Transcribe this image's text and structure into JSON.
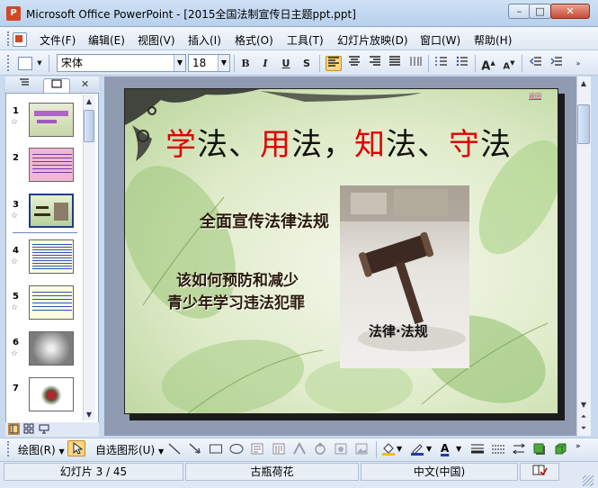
{
  "window": {
    "title": "Microsoft Office PowerPoint - [2015全国法制宣传日主题ppt.ppt]",
    "minimize": "–",
    "maximize": "□",
    "close": "✕"
  },
  "menu": [
    "文件(F)",
    "编辑(E)",
    "视图(V)",
    "插入(I)",
    "格式(O)",
    "工具(T)",
    "幻灯片放映(D)",
    "窗口(W)",
    "帮助(H)"
  ],
  "toolbar": {
    "font_name": "宋体",
    "font_size": "18",
    "bold": "B",
    "italic": "I",
    "underline": "U",
    "shadow": "S",
    "grow_font": "A",
    "shrink_font": "A"
  },
  "left_pane": {
    "slide_numbers": [
      "1",
      "2",
      "3",
      "4",
      "5",
      "6",
      "7"
    ],
    "close": "✕"
  },
  "slide": {
    "title_parts": [
      {
        "text": "学",
        "red": true
      },
      {
        "text": "法、",
        "red": false
      },
      {
        "text": "用",
        "red": true
      },
      {
        "text": "法，",
        "red": false
      },
      {
        "text": "知",
        "red": true
      },
      {
        "text": "法、",
        "red": false
      },
      {
        "text": "守",
        "red": true
      },
      {
        "text": "法",
        "red": false
      }
    ],
    "subtitle1": "全面宣传法律法规",
    "subtitle2": "该如何预防和减少",
    "subtitle3": "青少年学习违法犯罪",
    "image_caption": "法律·法规",
    "link_text": "返回"
  },
  "draw_toolbar": {
    "draw_label": "绘图(R)",
    "autoshapes_label": "自选图形(U)"
  },
  "status": {
    "slide_info": "幻灯片 3 / 45",
    "design": "古瓶荷花",
    "language": "中文(中国)"
  },
  "colors": {
    "title_red": "#e00000",
    "office_orange": "#d24726"
  }
}
